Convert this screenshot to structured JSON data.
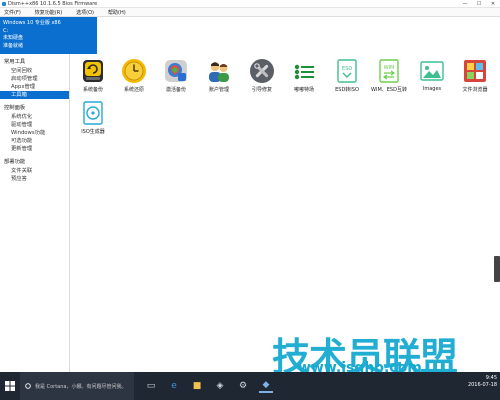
{
  "window": {
    "title": "Dism++x86 10.1.6.5 Bios Firmware",
    "controls": {
      "minimize": "—",
      "maximize": "☐",
      "close": "✕"
    }
  },
  "menu": [
    "文件(F)",
    "恢复功能(R)",
    "选项(O)",
    "帮助(H)"
  ],
  "info": {
    "os": "Windows 10 专业版 x86",
    "drive": "C:",
    "state": "未知硬盘",
    "status": "准备就绪"
  },
  "sidebar": {
    "groups": [
      {
        "label": "常用工具",
        "items": [
          {
            "label": "空间回收",
            "active": false
          },
          {
            "label": "启动项管理",
            "active": false
          },
          {
            "label": "Appx管理",
            "active": false
          },
          {
            "label": "工具箱",
            "active": true
          }
        ]
      },
      {
        "label": "控制面板",
        "items": [
          {
            "label": "系统优化",
            "active": false
          },
          {
            "label": "驱动管理",
            "active": false
          },
          {
            "label": "Windows功能",
            "active": false
          },
          {
            "label": "可选功能",
            "active": false
          },
          {
            "label": "更新管理",
            "active": false
          }
        ]
      },
      {
        "label": "部署功能",
        "items": [
          {
            "label": "文件关联",
            "active": false
          },
          {
            "label": "预应答",
            "active": false
          }
        ]
      }
    ]
  },
  "tools": [
    {
      "label": "系统备份",
      "icon": "backup-icon"
    },
    {
      "label": "系统还原",
      "icon": "restore-icon"
    },
    {
      "label": "激活备份",
      "icon": "activation-backup-icon"
    },
    {
      "label": "账户管理",
      "icon": "account-icon"
    },
    {
      "label": "引导修复",
      "icon": "boot-repair-icon"
    },
    {
      "label": "嘟嘟特场",
      "icon": "speed-icon"
    },
    {
      "label": "ESD转ISO",
      "icon": "esd-iso-icon"
    },
    {
      "label": "WIM、ESD互转",
      "icon": "wim-esd-icon"
    },
    {
      "label": "Images",
      "icon": "images-icon"
    },
    {
      "label": "文件浏览器",
      "icon": "file-browser-icon"
    },
    {
      "label": "ISO生成器",
      "icon": "iso-generator-icon"
    }
  ],
  "watermark": {
    "main": "技术员联盟",
    "url": "www.jsgho.com"
  },
  "taskbar": {
    "search_placeholder": "我是 Cortana，小娜。有问题尽管问我。",
    "time": "9:45",
    "date": "2016-07-18"
  },
  "colors": {
    "accent": "#0a6fcf",
    "taskbar": "#1f2733",
    "watermark": "#17a9d0"
  }
}
